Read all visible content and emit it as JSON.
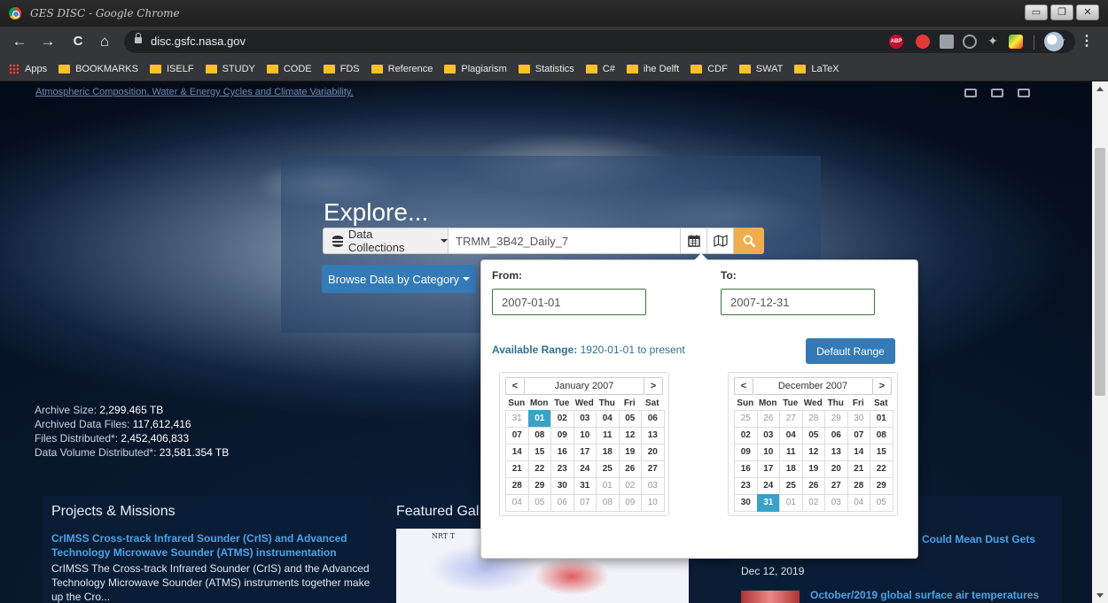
{
  "window": {
    "title": "GES DISC - Google Chrome",
    "buttons": [
      "▭",
      "❐",
      "✕"
    ]
  },
  "browser": {
    "url": "disc.gsfc.nasa.gov",
    "nav": {
      "back": "←",
      "forward": "→",
      "reload": "C",
      "home": "⌂"
    },
    "star": "★",
    "ext_abp": "ABP",
    "ext_5": "✦",
    "menu": "⋮",
    "bookmarks": [
      "Apps",
      "BOOKMARKS",
      "ISELF",
      "STUDY",
      "CODE",
      "FDS",
      "Reference",
      "Plagiarism",
      "Statistics",
      "C#",
      "ihe Delft",
      "CDF",
      "SWAT",
      "LaTeX"
    ]
  },
  "hero": {
    "top_links": "Atmospheric Composition, Water & Energy Cycles and Climate Variability.",
    "explore_title": "Explore...",
    "data_collections_label": "Data Collections",
    "search_value": "TRMM_3B42_Daily_7",
    "browse_label": "Browse Data by Category"
  },
  "stats": {
    "archive_size_label": "Archive Size:",
    "archive_size": "2,299.465 TB",
    "archived_files_label": "Archived Data Files:",
    "archived_files": "117,612,416",
    "files_distributed_label": "Files Distributed*:",
    "files_distributed": "2,452,406,833",
    "volume_distributed_label": "Data Volume Distributed*:",
    "volume_distributed": "23,581.354 TB"
  },
  "cards": {
    "projects_title": "Projects & Missions",
    "projects_link": "CrIMSS Cross-track Infrared Sounder (CrIS) and Advanced Technology Microwave Sounder (ATMS) instrumentation",
    "projects_desc": "CrIMSS   The Cross-track Infrared Sounder (CrIS) and the Advanced Technology Microwave Sounder (ATMS) instruments together make up the Cro...",
    "gallery_title": "Featured Gal",
    "gallery_caption": "NRT T",
    "news_link_1": "Could Mean Dust Gets",
    "news_date": "Dec 12, 2019",
    "news_link_2": "October/2019 global surface air temperatures"
  },
  "datepicker": {
    "from_label": "From:",
    "to_label": "To:",
    "from_value": "2007-01-01",
    "to_value": "2007-12-31",
    "available_label": "Available Range:",
    "available_value": "1920-01-01 to present",
    "default_button": "Default Range",
    "prev": "<",
    "next": ">",
    "dow": [
      "Sun",
      "Mon",
      "Tue",
      "Wed",
      "Thu",
      "Fri",
      "Sat"
    ],
    "from_calendar": {
      "month": "January 2007",
      "weeks": [
        [
          "31",
          "01",
          "02",
          "03",
          "04",
          "05",
          "06"
        ],
        [
          "07",
          "08",
          "09",
          "10",
          "11",
          "12",
          "13"
        ],
        [
          "14",
          "15",
          "16",
          "17",
          "18",
          "19",
          "20"
        ],
        [
          "21",
          "22",
          "23",
          "24",
          "25",
          "26",
          "27"
        ],
        [
          "28",
          "29",
          "30",
          "31",
          "01",
          "02",
          "03"
        ],
        [
          "04",
          "05",
          "06",
          "07",
          "08",
          "09",
          "10"
        ]
      ],
      "muted": [
        [
          0,
          0
        ],
        [
          4,
          4
        ],
        [
          4,
          5
        ],
        [
          4,
          6
        ],
        [
          5,
          0
        ],
        [
          5,
          1
        ],
        [
          5,
          2
        ],
        [
          5,
          3
        ],
        [
          5,
          4
        ],
        [
          5,
          5
        ],
        [
          5,
          6
        ]
      ],
      "selected": [
        0,
        1
      ]
    },
    "to_calendar": {
      "month": "December 2007",
      "weeks": [
        [
          "25",
          "26",
          "27",
          "28",
          "29",
          "30",
          "01"
        ],
        [
          "02",
          "03",
          "04",
          "05",
          "06",
          "07",
          "08"
        ],
        [
          "09",
          "10",
          "11",
          "12",
          "13",
          "14",
          "15"
        ],
        [
          "16",
          "17",
          "18",
          "19",
          "20",
          "21",
          "22"
        ],
        [
          "23",
          "24",
          "25",
          "26",
          "27",
          "28",
          "29"
        ],
        [
          "30",
          "31",
          "01",
          "02",
          "03",
          "04",
          "05"
        ]
      ],
      "muted": [
        [
          0,
          0
        ],
        [
          0,
          1
        ],
        [
          0,
          2
        ],
        [
          0,
          3
        ],
        [
          0,
          4
        ],
        [
          0,
          5
        ],
        [
          5,
          2
        ],
        [
          5,
          3
        ],
        [
          5,
          4
        ],
        [
          5,
          5
        ],
        [
          5,
          6
        ]
      ],
      "selected": [
        5,
        1
      ]
    }
  },
  "colors": {
    "primary": "#337ab7",
    "search_button": "#f0ad4e",
    "selected_day": "#3aa2c9",
    "link": "#4aa3e8"
  }
}
